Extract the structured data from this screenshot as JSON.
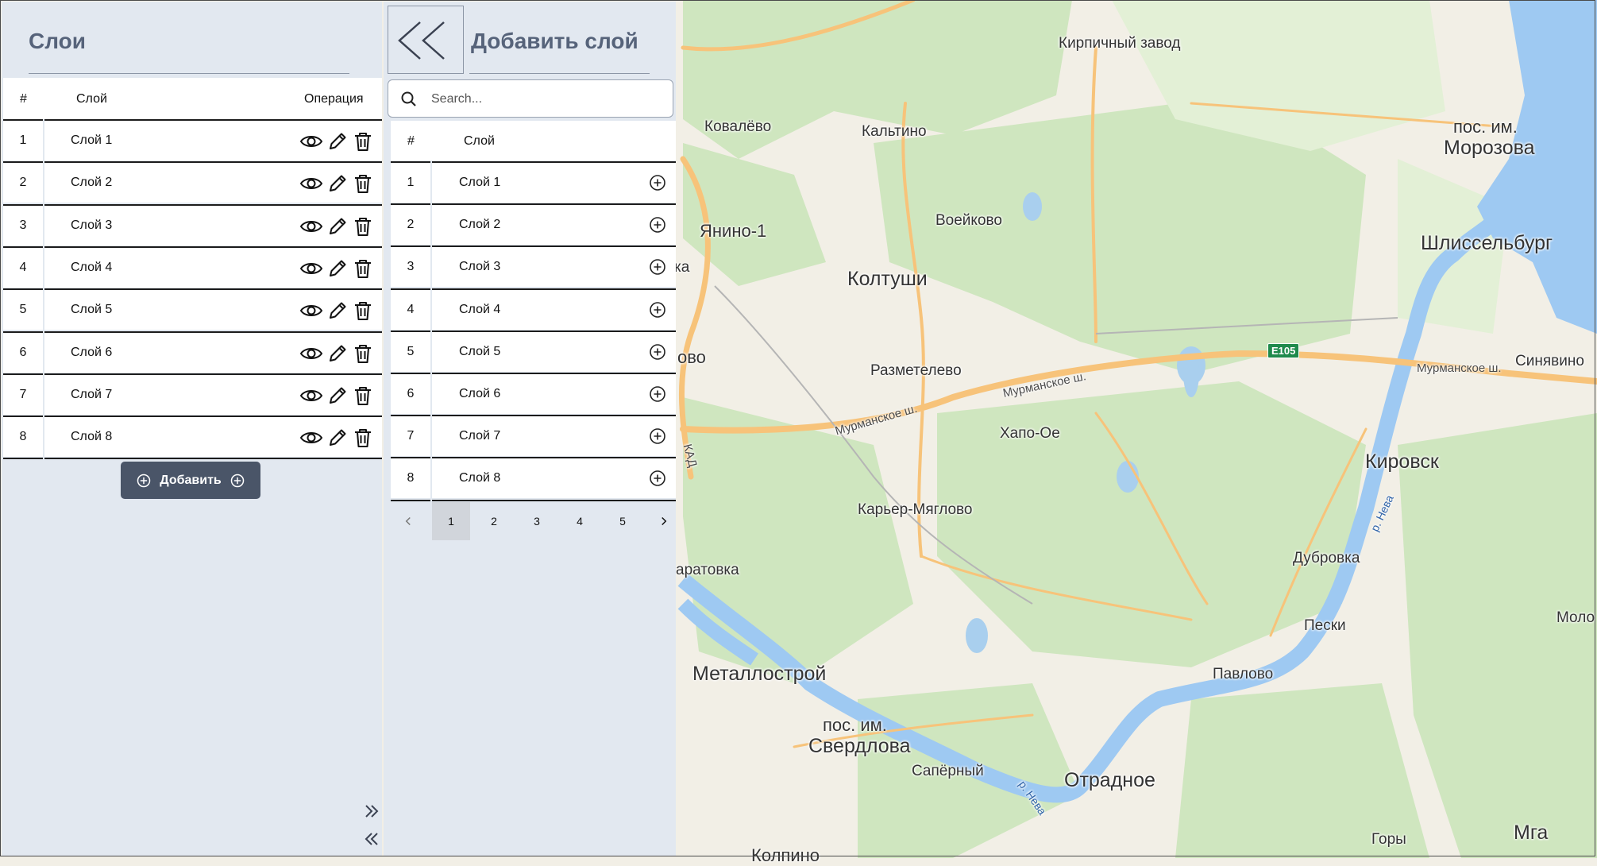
{
  "left_panel": {
    "title": "Слои",
    "columns": {
      "index": "#",
      "layer": "Слой",
      "operation": "Операция"
    },
    "rows": [
      {
        "index": "1",
        "name": "Слой 1"
      },
      {
        "index": "2",
        "name": "Слой 2"
      },
      {
        "index": "3",
        "name": "Слой 3"
      },
      {
        "index": "4",
        "name": "Слой 4"
      },
      {
        "index": "5",
        "name": "Слой 5"
      },
      {
        "index": "6",
        "name": "Слой 6"
      },
      {
        "index": "7",
        "name": "Слой 7"
      },
      {
        "index": "8",
        "name": "Слой 8"
      }
    ],
    "add_button_label": "Добавить",
    "icons": {
      "view": "eye-icon",
      "edit": "pencil-icon",
      "delete": "trash-icon",
      "expand": "chevrons-right-icon",
      "collapse": "chevrons-left-icon"
    }
  },
  "right_panel": {
    "title": "Добавить слой",
    "search": {
      "placeholder": "Search...",
      "value": ""
    },
    "columns": {
      "index": "#",
      "layer": "Слой"
    },
    "rows": [
      {
        "index": "1",
        "name": "Слой 1"
      },
      {
        "index": "2",
        "name": "Слой 2"
      },
      {
        "index": "3",
        "name": "Слой 3"
      },
      {
        "index": "4",
        "name": "Слой 4"
      },
      {
        "index": "5",
        "name": "Слой 5"
      },
      {
        "index": "6",
        "name": "Слой 6"
      },
      {
        "index": "7",
        "name": "Слой 7"
      },
      {
        "index": "8",
        "name": "Слой 8"
      }
    ],
    "pagination": {
      "pages": [
        "1",
        "2",
        "3",
        "4",
        "5"
      ],
      "current": "1"
    }
  },
  "map": {
    "labels": [
      "Кирпичный завод",
      "Ковалёво",
      "Кальтино",
      "пос. им.",
      "Морозова",
      "Янино-1",
      "Воейково",
      "Колтуши",
      "Шлиссельбург",
      "Разметелево",
      "Мурманское ш.",
      "Мурманское ш.",
      "Мурманское ш.",
      "Синявино",
      "Хапо-Ое",
      "Кировск",
      "Карьер-Мяглово",
      "Дубровка",
      "Пески",
      "Моло",
      "Металлострой",
      "Павлово",
      "пос. им.",
      "Свердлова",
      "Сапёрный",
      "Отрадное",
      "Мга",
      "Горы",
      "КАД",
      "р. Нева",
      "р. Нева",
      "ка",
      "ово",
      "аратовка",
      "Колпино"
    ],
    "road_shield": "E105",
    "colors": {
      "land": "#f2efe6",
      "forest": "#cfe6bf",
      "water": "#9ec9f2",
      "road": "#f7c37a",
      "panel": "#e2e8f0",
      "button": "#4a5568"
    }
  }
}
